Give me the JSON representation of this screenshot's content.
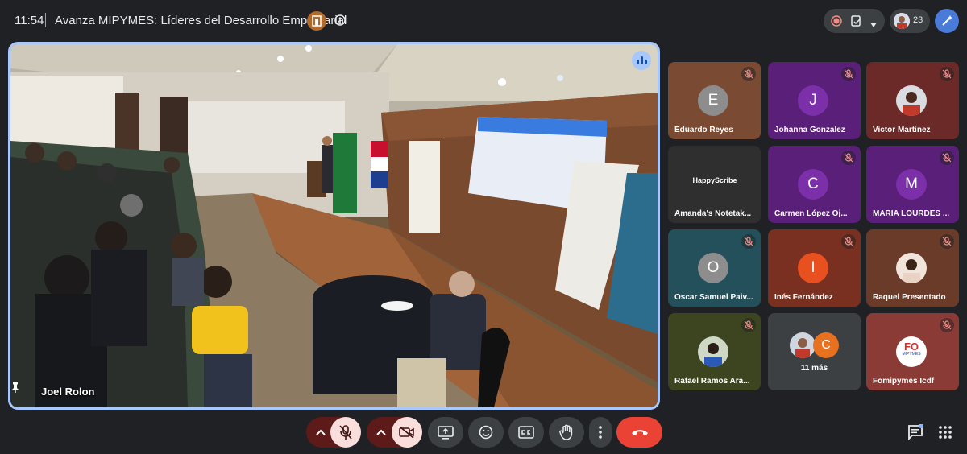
{
  "header": {
    "time": "11:54",
    "meeting_title": "Avanza MIPYMES: Líderes del Desarrollo Empresarial",
    "participant_count": "23"
  },
  "main_stage": {
    "speaker_name": "Joel Rolon"
  },
  "participants": [
    {
      "name": "Eduardo Reyes",
      "initial": "E",
      "muted": true,
      "bg": "#7a4a33",
      "avatar_color": "#8d8d8d"
    },
    {
      "name": "Johanna Gonzalez",
      "initial": "J",
      "muted": true,
      "bg": "#5a1f78",
      "avatar_color": "#7b2fa8"
    },
    {
      "name": "Victor Martinez",
      "initial": "",
      "muted": true,
      "bg": "#6b2a28",
      "avatar_color": ""
    },
    {
      "name": "Amanda's Notetak...",
      "initial": "",
      "muted": false,
      "bg": "#2f2f2f",
      "avatar_color": ""
    },
    {
      "name": "Carmen López Oj...",
      "initial": "C",
      "muted": true,
      "bg": "#5a1f78",
      "avatar_color": "#7b2fa8"
    },
    {
      "name": "MARIA LOURDES ...",
      "initial": "M",
      "muted": true,
      "bg": "#5a1f78",
      "avatar_color": "#7b2fa8"
    },
    {
      "name": "Oscar Samuel Paiv...",
      "initial": "O",
      "muted": true,
      "bg": "#24505c",
      "avatar_color": "#8d8d8d"
    },
    {
      "name": "Inés Fernández",
      "initial": "I",
      "muted": true,
      "bg": "#7a3020",
      "avatar_color": "#e8501f"
    },
    {
      "name": "Raquel Presentado",
      "initial": "",
      "muted": true,
      "bg": "#6b3b2a",
      "avatar_color": ""
    },
    {
      "name": "Rafael Ramos Ara...",
      "initial": "",
      "muted": true,
      "bg": "#3d4420",
      "avatar_color": ""
    },
    {
      "name": "11 más",
      "initial": "C",
      "muted": false,
      "bg": "#3c4043",
      "avatar_color": "#e8711f"
    },
    {
      "name": "Fomipymes Icdf",
      "initial": "",
      "muted": true,
      "bg": "#8a3b36",
      "avatar_color": ""
    }
  ],
  "tile_labels": {
    "notetaker_brand": "HappyScribe",
    "logo_text": "FO",
    "logo_sub": "MIPYMES"
  },
  "icons": {
    "record": "record-icon",
    "activities": "activities-icon",
    "mic": "mic-off-icon",
    "camera": "camera-off-icon",
    "present": "present-screen-icon",
    "emoji": "emoji-icon",
    "captions": "captions-icon",
    "hand": "raise-hand-icon",
    "more": "more-options-icon",
    "hangup": "hang-up-icon",
    "chat": "chat-icon",
    "apps": "apps-grid-icon"
  },
  "colors": {
    "accent": "#a8c7fa",
    "hangup": "#ea4335",
    "mic_off_bg": "#f9dedc"
  }
}
